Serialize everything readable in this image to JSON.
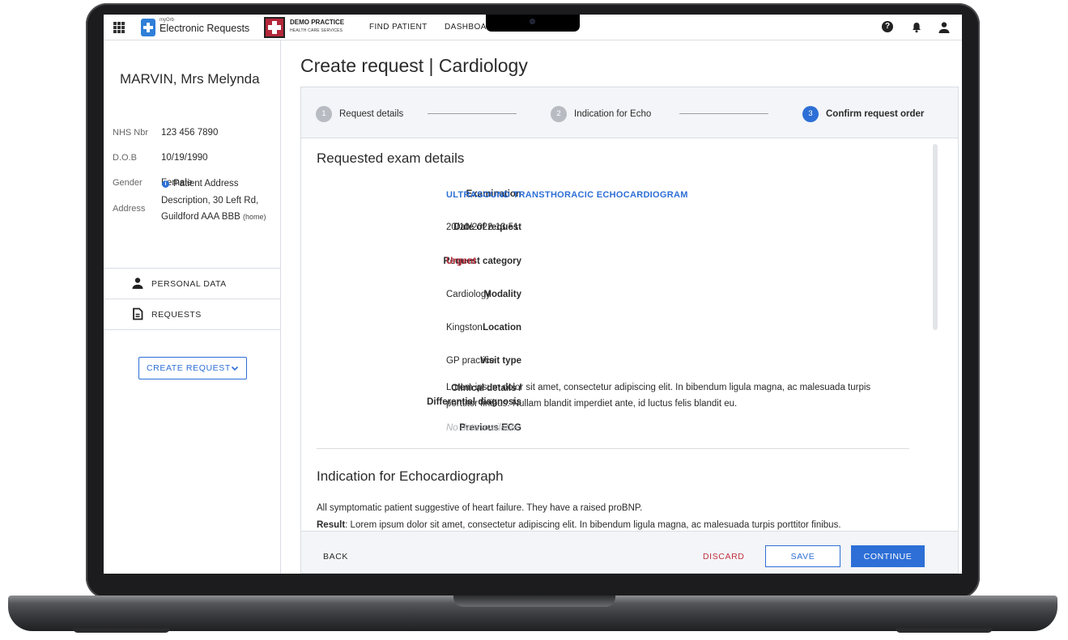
{
  "header": {
    "brand_small": "myOrb",
    "brand_main": "Electronic Requests",
    "practice_name": "DEMO PRACTICE",
    "practice_sub": "HEALTH CARE SERVICES",
    "nav": {
      "find_patient": "FIND PATIENT",
      "dashboard": "DASHBOA"
    },
    "icons": [
      "apps-grid-icon",
      "help-icon",
      "bell-icon",
      "user-icon"
    ]
  },
  "patient": {
    "name": "MARVIN, Mrs Melynda",
    "nhs_label": "NHS Nbr",
    "nhs_value": "123 456 7890",
    "dob_label": "D.O.B",
    "dob_value": "10/19/1990",
    "gender_label": "Gender",
    "gender_value": "Female",
    "address_label": "Address",
    "address_line1": "Patient Address",
    "address_line2": "Description, 30 Left Rd,",
    "address_line3": "Guildford AAA BBB",
    "address_tag": "(home)"
  },
  "sidebar": {
    "personal_data": "PERSONAL DATA",
    "requests": "REQUESTS",
    "create_request": "CREATE REQUEST"
  },
  "page": {
    "title": "Create request | Cardiology"
  },
  "stepper": {
    "steps": [
      {
        "number": "1",
        "label": "Request details",
        "state": "done"
      },
      {
        "number": "2",
        "label": "Indication for Echo",
        "state": "done"
      },
      {
        "number": "3",
        "label": "Confirm request order",
        "state": "active"
      }
    ]
  },
  "exam": {
    "section_title": "Requested exam details",
    "fields": [
      {
        "label": "Examination",
        "value": "ULTRASOUND TRANSTHORACIC ECHOCARDIOGRAM"
      },
      {
        "label": "Date of request",
        "value": "20/10/2022 13:51"
      },
      {
        "label": "Request category",
        "value": "Urgent"
      },
      {
        "label": "Modality",
        "value": "Cardiology"
      },
      {
        "label": "Location",
        "value": "Kingston"
      },
      {
        "label": "Visit type",
        "value": "GP practice"
      },
      {
        "label_line1": "Clinical details /",
        "label_line2": "Differential diagnosis",
        "value_line1": "Lorem ipsum dolor sit amet, consectetur adipiscing elit. In bibendum ligula magna, ac malesuada turpis",
        "value_line2": "porttitor finibus. Nullam blandit imperdiet ante, id luctus felis blandit eu."
      },
      {
        "label": "Previous ECG",
        "value": "No data available"
      }
    ]
  },
  "indication": {
    "section_title": "Indication for Echocardiograph",
    "text": "All symptomatic patient suggestive of heart failure. They have a raised proBNP.",
    "result_label": "Result",
    "result_text": ": Lorem ipsum dolor sit amet, consectetur adipiscing elit. In bibendum ligula magna, ac malesuada turpis porttitor finibus."
  },
  "footer": {
    "back": "BACK",
    "discard": "DISCARD",
    "save": "SAVE",
    "continue": "CONTINUE"
  },
  "colors": {
    "accent": "#2d6fd6",
    "danger": "#c0303f",
    "brand_red": "#b3283a"
  }
}
